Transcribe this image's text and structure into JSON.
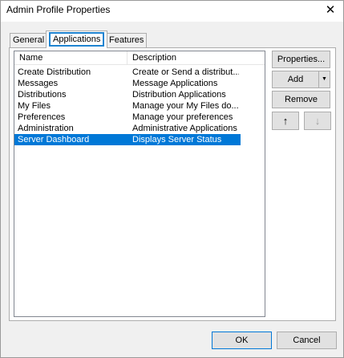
{
  "window": {
    "title": "Admin Profile Properties",
    "close_glyph": "✕"
  },
  "tabs": [
    {
      "label": "General",
      "active": false
    },
    {
      "label": "Applications",
      "active": true
    },
    {
      "label": "Features",
      "active": false
    }
  ],
  "list": {
    "columns": [
      "Name",
      "Description"
    ],
    "rows": [
      {
        "name": "Create Distribution",
        "description": "Create or Send a distribut..."
      },
      {
        "name": "Messages",
        "description": "Message Applications"
      },
      {
        "name": "Distributions",
        "description": "Distribution Applications"
      },
      {
        "name": "My Files",
        "description": "Manage your My Files do..."
      },
      {
        "name": "Preferences",
        "description": "Manage your preferences"
      },
      {
        "name": "Administration",
        "description": "Administrative Applications"
      },
      {
        "name": "Server Dashboard",
        "description": "Displays Server Status",
        "selected": true
      }
    ]
  },
  "side_buttons": {
    "properties": "Properties...",
    "add": "Add",
    "remove": "Remove",
    "move_up_icon": "↑",
    "move_down_icon": "↓"
  },
  "footer": {
    "ok": "OK",
    "cancel": "Cancel"
  },
  "colors": {
    "selection": "#0078d7",
    "tab_highlight": "#1f84d1"
  }
}
